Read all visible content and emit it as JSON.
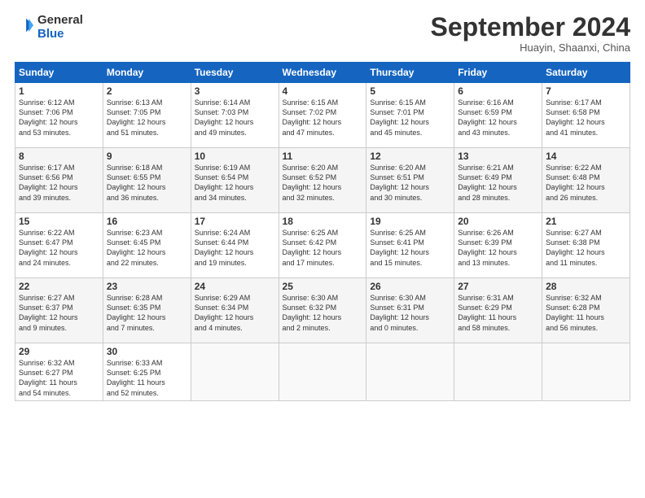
{
  "logo": {
    "line1": "General",
    "line2": "Blue"
  },
  "title": "September 2024",
  "subtitle": "Huayin, Shaanxi, China",
  "days_of_week": [
    "Sunday",
    "Monday",
    "Tuesday",
    "Wednesday",
    "Thursday",
    "Friday",
    "Saturday"
  ],
  "weeks": [
    [
      {
        "day": "1",
        "info": "Sunrise: 6:12 AM\nSunset: 7:06 PM\nDaylight: 12 hours\nand 53 minutes."
      },
      {
        "day": "2",
        "info": "Sunrise: 6:13 AM\nSunset: 7:05 PM\nDaylight: 12 hours\nand 51 minutes."
      },
      {
        "day": "3",
        "info": "Sunrise: 6:14 AM\nSunset: 7:03 PM\nDaylight: 12 hours\nand 49 minutes."
      },
      {
        "day": "4",
        "info": "Sunrise: 6:15 AM\nSunset: 7:02 PM\nDaylight: 12 hours\nand 47 minutes."
      },
      {
        "day": "5",
        "info": "Sunrise: 6:15 AM\nSunset: 7:01 PM\nDaylight: 12 hours\nand 45 minutes."
      },
      {
        "day": "6",
        "info": "Sunrise: 6:16 AM\nSunset: 6:59 PM\nDaylight: 12 hours\nand 43 minutes."
      },
      {
        "day": "7",
        "info": "Sunrise: 6:17 AM\nSunset: 6:58 PM\nDaylight: 12 hours\nand 41 minutes."
      }
    ],
    [
      {
        "day": "8",
        "info": "Sunrise: 6:17 AM\nSunset: 6:56 PM\nDaylight: 12 hours\nand 39 minutes."
      },
      {
        "day": "9",
        "info": "Sunrise: 6:18 AM\nSunset: 6:55 PM\nDaylight: 12 hours\nand 36 minutes."
      },
      {
        "day": "10",
        "info": "Sunrise: 6:19 AM\nSunset: 6:54 PM\nDaylight: 12 hours\nand 34 minutes."
      },
      {
        "day": "11",
        "info": "Sunrise: 6:20 AM\nSunset: 6:52 PM\nDaylight: 12 hours\nand 32 minutes."
      },
      {
        "day": "12",
        "info": "Sunrise: 6:20 AM\nSunset: 6:51 PM\nDaylight: 12 hours\nand 30 minutes."
      },
      {
        "day": "13",
        "info": "Sunrise: 6:21 AM\nSunset: 6:49 PM\nDaylight: 12 hours\nand 28 minutes."
      },
      {
        "day": "14",
        "info": "Sunrise: 6:22 AM\nSunset: 6:48 PM\nDaylight: 12 hours\nand 26 minutes."
      }
    ],
    [
      {
        "day": "15",
        "info": "Sunrise: 6:22 AM\nSunset: 6:47 PM\nDaylight: 12 hours\nand 24 minutes."
      },
      {
        "day": "16",
        "info": "Sunrise: 6:23 AM\nSunset: 6:45 PM\nDaylight: 12 hours\nand 22 minutes."
      },
      {
        "day": "17",
        "info": "Sunrise: 6:24 AM\nSunset: 6:44 PM\nDaylight: 12 hours\nand 19 minutes."
      },
      {
        "day": "18",
        "info": "Sunrise: 6:25 AM\nSunset: 6:42 PM\nDaylight: 12 hours\nand 17 minutes."
      },
      {
        "day": "19",
        "info": "Sunrise: 6:25 AM\nSunset: 6:41 PM\nDaylight: 12 hours\nand 15 minutes."
      },
      {
        "day": "20",
        "info": "Sunrise: 6:26 AM\nSunset: 6:39 PM\nDaylight: 12 hours\nand 13 minutes."
      },
      {
        "day": "21",
        "info": "Sunrise: 6:27 AM\nSunset: 6:38 PM\nDaylight: 12 hours\nand 11 minutes."
      }
    ],
    [
      {
        "day": "22",
        "info": "Sunrise: 6:27 AM\nSunset: 6:37 PM\nDaylight: 12 hours\nand 9 minutes."
      },
      {
        "day": "23",
        "info": "Sunrise: 6:28 AM\nSunset: 6:35 PM\nDaylight: 12 hours\nand 7 minutes."
      },
      {
        "day": "24",
        "info": "Sunrise: 6:29 AM\nSunset: 6:34 PM\nDaylight: 12 hours\nand 4 minutes."
      },
      {
        "day": "25",
        "info": "Sunrise: 6:30 AM\nSunset: 6:32 PM\nDaylight: 12 hours\nand 2 minutes."
      },
      {
        "day": "26",
        "info": "Sunrise: 6:30 AM\nSunset: 6:31 PM\nDaylight: 12 hours\nand 0 minutes."
      },
      {
        "day": "27",
        "info": "Sunrise: 6:31 AM\nSunset: 6:29 PM\nDaylight: 11 hours\nand 58 minutes."
      },
      {
        "day": "28",
        "info": "Sunrise: 6:32 AM\nSunset: 6:28 PM\nDaylight: 11 hours\nand 56 minutes."
      }
    ],
    [
      {
        "day": "29",
        "info": "Sunrise: 6:32 AM\nSunset: 6:27 PM\nDaylight: 11 hours\nand 54 minutes."
      },
      {
        "day": "30",
        "info": "Sunrise: 6:33 AM\nSunset: 6:25 PM\nDaylight: 11 hours\nand 52 minutes."
      },
      {
        "day": "",
        "info": ""
      },
      {
        "day": "",
        "info": ""
      },
      {
        "day": "",
        "info": ""
      },
      {
        "day": "",
        "info": ""
      },
      {
        "day": "",
        "info": ""
      }
    ]
  ]
}
